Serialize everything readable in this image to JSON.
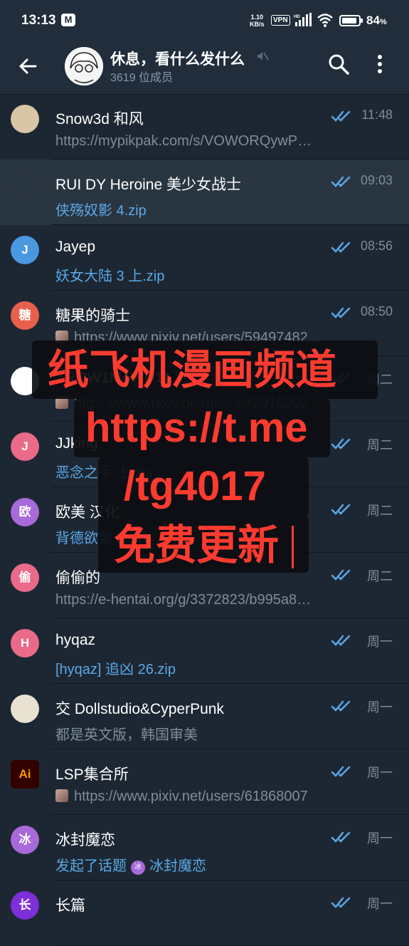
{
  "status_bar": {
    "time": "13:13",
    "net_speed_value": "1.10",
    "net_speed_unit": "KB/s",
    "vpn": "VPN",
    "battery": "84",
    "battery_unit": "%"
  },
  "header": {
    "title": "休息，看什么发什么",
    "subtitle": "3619 位成员"
  },
  "chats": [
    {
      "name": "Snow3d 和风",
      "message": "https://mypikpak.com/s/VOWORQywP…",
      "time": "11:48",
      "message_style": "gray",
      "avatar_color": "#d8c6a6",
      "avatar_letter": ""
    },
    {
      "name": "RUI DY Heroine 美少女战士",
      "message": "侠殇奴影 4.zip",
      "time": "09:03",
      "message_style": "blue",
      "avatar_color": "#2a3542",
      "avatar_letter": ""
    },
    {
      "name": "Jayep",
      "message": "妖女大陆  3 上.zip",
      "time": "08:56",
      "message_style": "blue",
      "avatar_color": "#4a98e0",
      "avatar_letter": "J"
    },
    {
      "name": "糖果的骑士",
      "message": "https://www.pixiv.net/users/59497482…",
      "time": "08:50",
      "message_style": "gray",
      "avatar_color": "#e8604c",
      "avatar_letter": "糖"
    },
    {
      "name": "ZRQW1M4WD11",
      "message": "https://www.pixiv.net/users/42916202…",
      "time": "周二",
      "message_style": "gray",
      "avatar_color": "#ffffff",
      "avatar_letter": ""
    },
    {
      "name": "JJking",
      "message": "恶念之手 上.zip",
      "time": "周二",
      "message_style": "blue",
      "avatar_color": "#ea6a8a",
      "avatar_letter": "J"
    },
    {
      "name": "欧美 汉化",
      "message": "背德欲望 2.zip",
      "time": "周二",
      "message_style": "blue",
      "avatar_color": "#a86ad8",
      "avatar_letter": "欧"
    },
    {
      "name": "偷偷的",
      "message": "https://e-hentai.org/g/3372823/b995a8…",
      "time": "周二",
      "message_style": "gray",
      "avatar_color": "#ea6a8a",
      "avatar_letter": "偷"
    },
    {
      "name": "hyqaz",
      "message": "[hyqaz] 追凶 26.zip",
      "time": "周一",
      "message_style": "blue",
      "avatar_color": "#ea6a8a",
      "avatar_letter": "H"
    },
    {
      "name": "交 Dollstudio&CyperPunk",
      "message": "都是英文版，韩国审美",
      "time": "周一",
      "message_style": "gray",
      "avatar_color": "#e9e2d2",
      "avatar_letter": ""
    },
    {
      "name": "LSP集合所",
      "message": "https://www.pixiv.net/users/61868007",
      "time": "周一",
      "message_style": "gray",
      "avatar_color": "#330000",
      "avatar_letter": "Ai"
    },
    {
      "name": "冰封魔恋",
      "message": "发起了话题",
      "message_topic": "冰封魔恋",
      "time": "周一",
      "message_style": "blue",
      "avatar_color": "#a86ad8",
      "avatar_letter": "冰"
    },
    {
      "name": "长篇",
      "message": "",
      "time": "周一",
      "message_style": "gray",
      "avatar_color": "#7d2fd8",
      "avatar_letter": "长"
    }
  ],
  "overlay": {
    "line1": "纸飞机漫画频道",
    "line2": "https://t.me",
    "line3": "/tg4017",
    "line4": "免费更新"
  },
  "colors": {
    "background": "#1d2733",
    "header": "#212d3b",
    "accent_blue": "#5aa8e6",
    "overlay_red": "#ff3b30"
  }
}
